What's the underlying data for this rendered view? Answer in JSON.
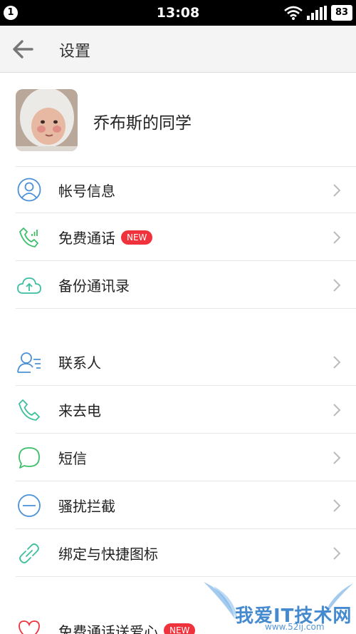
{
  "status_bar": {
    "notification_count": "1",
    "time": "13:08",
    "battery": "83"
  },
  "header": {
    "title": "设置"
  },
  "profile": {
    "name": "乔布斯的同学"
  },
  "group1": [
    {
      "label": "帐号信息",
      "icon": "account-icon"
    },
    {
      "label": "免费通话",
      "icon": "call-signal-icon",
      "badge": "NEW"
    },
    {
      "label": "备份通讯录",
      "icon": "cloud-upload-icon"
    }
  ],
  "group2": [
    {
      "label": "联系人",
      "icon": "contacts-icon"
    },
    {
      "label": "来去电",
      "icon": "phone-icon"
    },
    {
      "label": "短信",
      "icon": "message-icon"
    },
    {
      "label": "骚扰拦截",
      "icon": "block-icon"
    },
    {
      "label": "绑定与快捷图标",
      "icon": "link-icon"
    }
  ],
  "group3": [
    {
      "label": "免费通话送爱心",
      "icon": "heart-icon",
      "badge": "NEW"
    }
  ],
  "watermark": {
    "text": "我爱IT技术网",
    "url": "www.52ij.com"
  },
  "colors": {
    "icon_blue": "#4a90d9",
    "icon_green": "#3cbf6a",
    "badge_red": "#f0323c",
    "header_bg": "#f4f4f4"
  }
}
